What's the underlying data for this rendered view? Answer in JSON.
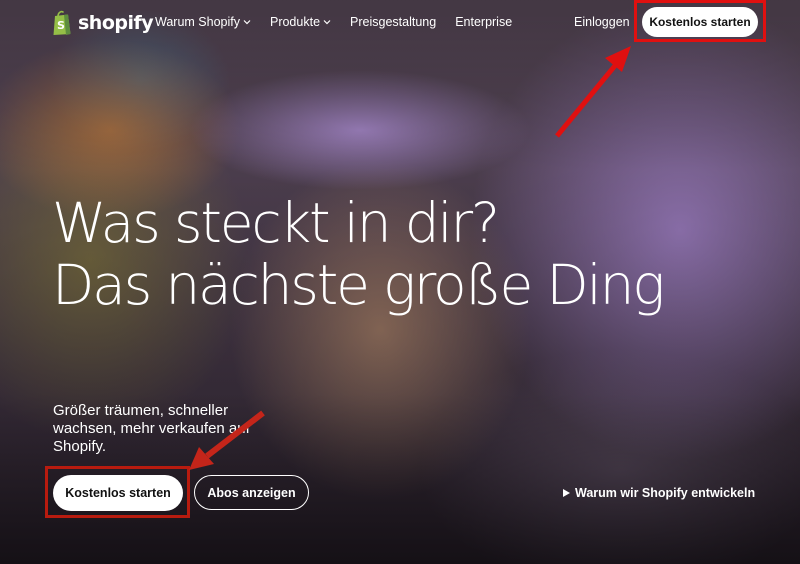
{
  "brand": {
    "logo_text": "shopify",
    "logo_icon": "shopify-bag-icon",
    "color": "#95bf47"
  },
  "nav": {
    "items": [
      {
        "label": "Warum Shopify",
        "has_dropdown": true
      },
      {
        "label": "Produkte",
        "has_dropdown": true
      },
      {
        "label": "Preisgestaltung",
        "has_dropdown": false
      },
      {
        "label": "Enterprise",
        "has_dropdown": false
      }
    ],
    "login_label": "Einloggen",
    "cta_label": "Kostenlos starten"
  },
  "hero": {
    "headline_line1": "Was steckt in dir?",
    "headline_line2": "Das nächste große Ding",
    "subtext": "Größer träumen, schneller wachsen, mehr verkaufen auf Shopify.",
    "primary_button": "Kostenlos starten",
    "secondary_button": "Abos anzeigen",
    "video_link": "Warum wir Shopify entwickeln",
    "video_link_icon": "play-icon"
  },
  "annotations": {
    "highlight_color": "#e01010",
    "arrow_icon": "red-arrow-icon"
  }
}
